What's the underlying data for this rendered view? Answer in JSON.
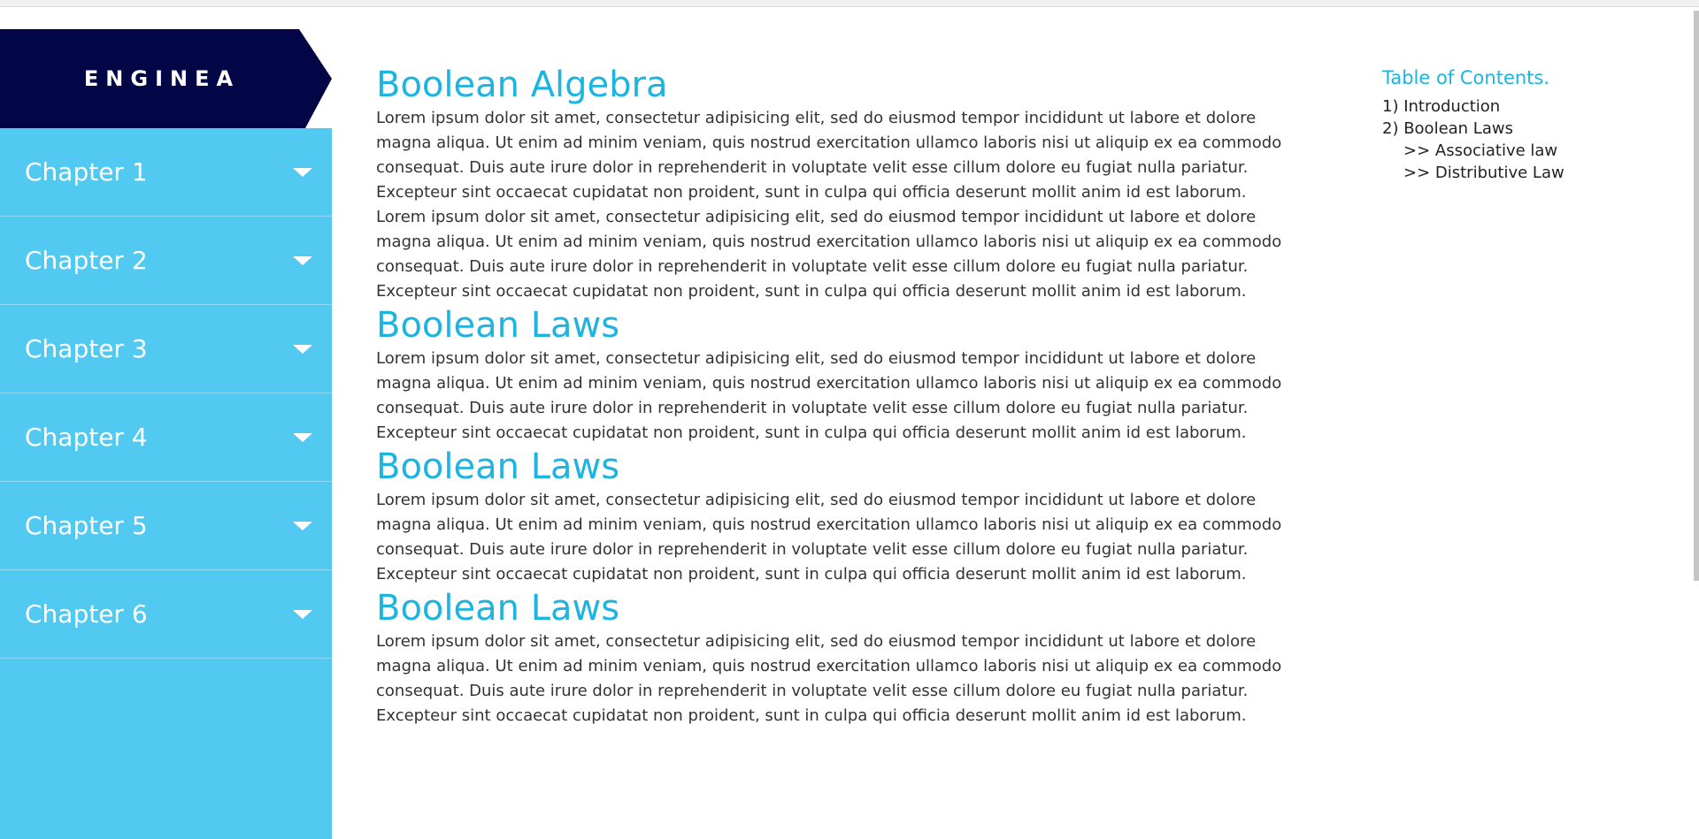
{
  "brand": {
    "name": "ENGINEA"
  },
  "sidebar": {
    "chapters": [
      {
        "label": "Chapter 1"
      },
      {
        "label": "Chapter 2"
      },
      {
        "label": "Chapter 3"
      },
      {
        "label": "Chapter 4"
      },
      {
        "label": "Chapter 5"
      },
      {
        "label": "Chapter 6"
      }
    ]
  },
  "main": {
    "sections": [
      {
        "title": "Boolean Algebra",
        "paragraphs": [
          "Lorem ipsum dolor sit amet, consectetur adipisicing elit, sed do eiusmod tempor incididunt ut labore et dolore magna aliqua. Ut enim ad minim veniam, quis nostrud exercitation ullamco laboris nisi ut aliquip ex ea commodo consequat. Duis aute irure dolor in reprehenderit in voluptate velit esse cillum dolore eu fugiat nulla pariatur. Excepteur sint occaecat cupidatat non proident, sunt in culpa qui officia deserunt mollit anim id est laborum.",
          "Lorem ipsum dolor sit amet, consectetur adipisicing elit, sed do eiusmod tempor incididunt ut labore et dolore magna aliqua. Ut enim ad minim veniam, quis nostrud exercitation ullamco laboris nisi ut aliquip ex ea commodo consequat. Duis aute irure dolor in reprehenderit in voluptate velit esse cillum dolore eu fugiat nulla pariatur. Excepteur sint occaecat cupidatat non proident, sunt in culpa qui officia deserunt mollit anim id est laborum."
        ]
      },
      {
        "title": "Boolean Laws",
        "paragraphs": [
          "Lorem ipsum dolor sit amet, consectetur adipisicing elit, sed do eiusmod tempor incididunt ut labore et dolore magna aliqua. Ut enim ad minim veniam, quis nostrud exercitation ullamco laboris nisi ut aliquip ex ea commodo consequat. Duis aute irure dolor in reprehenderit in voluptate velit esse cillum dolore eu fugiat nulla pariatur. Excepteur sint occaecat cupidatat non proident, sunt in culpa qui officia deserunt mollit anim id est laborum."
        ]
      },
      {
        "title": "Boolean Laws",
        "paragraphs": [
          "Lorem ipsum dolor sit amet, consectetur adipisicing elit, sed do eiusmod tempor incididunt ut labore et dolore magna aliqua. Ut enim ad minim veniam, quis nostrud exercitation ullamco laboris nisi ut aliquip ex ea commodo consequat. Duis aute irure dolor in reprehenderit in voluptate velit esse cillum dolore eu fugiat nulla pariatur. Excepteur sint occaecat cupidatat non proident, sunt in culpa qui officia deserunt mollit anim id est laborum."
        ]
      },
      {
        "title": "Boolean Laws",
        "paragraphs": [
          "Lorem ipsum dolor sit amet, consectetur adipisicing elit, sed do eiusmod tempor incididunt ut labore et dolore magna aliqua. Ut enim ad minim veniam, quis nostrud exercitation ullamco laboris nisi ut aliquip ex ea commodo consequat. Duis aute irure dolor in reprehenderit in voluptate velit esse cillum dolore eu fugiat nulla pariatur. Excepteur sint occaecat cupidatat non proident, sunt in culpa qui officia deserunt mollit anim id est laborum."
        ]
      }
    ]
  },
  "toc": {
    "title": "Table of Contents.",
    "items": [
      {
        "label": "1) Introduction",
        "sub": false
      },
      {
        "label": "2) Boolean Laws",
        "sub": false
      },
      {
        "label": ">> Associative law",
        "sub": true
      },
      {
        "label": ">> Distributive Law",
        "sub": true
      }
    ]
  },
  "icons": {
    "chapter_toggle": "chevron-down-icon"
  },
  "colors": {
    "brand_bg": "#020647",
    "sidebar_bg": "#52c9f1",
    "heading": "#1eb4e0",
    "body_text": "#333333"
  }
}
